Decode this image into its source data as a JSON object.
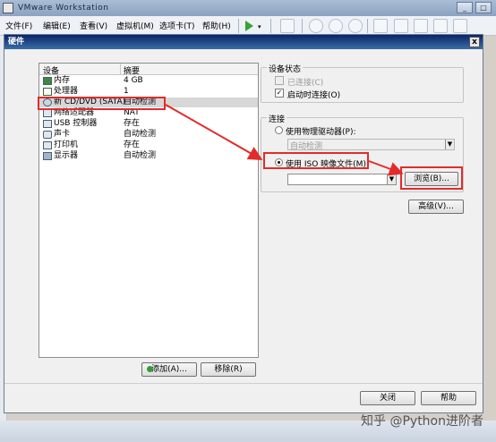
{
  "app": {
    "title": "VMware Workstation",
    "min": "_",
    "max": "□"
  },
  "menubar": {
    "items": [
      "文件(F)",
      "编辑(E)",
      "查看(V)",
      "虚拟机(M)",
      "选项卡(T)",
      "帮助(H)"
    ]
  },
  "dialog": {
    "title": "硬件",
    "close": "x",
    "list": {
      "headers": [
        "设备",
        "摘要"
      ],
      "rows": [
        {
          "icon": "memory-icon",
          "name": "内存",
          "summary": "4 GB"
        },
        {
          "icon": "cpu-icon",
          "name": "处理器",
          "summary": "1"
        },
        {
          "icon": "cd-dvd-icon",
          "name": "新 CD/DVD (SATA)",
          "summary": "自动检测"
        },
        {
          "icon": "network-adapter-icon",
          "name": "网络适配器",
          "summary": "NAT"
        },
        {
          "icon": "usb-icon",
          "name": "USB 控制器",
          "summary": "存在"
        },
        {
          "icon": "sound-card-icon",
          "name": "声卡",
          "summary": "自动检测"
        },
        {
          "icon": "printer-icon",
          "name": "打印机",
          "summary": "存在"
        },
        {
          "icon": "display-icon",
          "name": "显示器",
          "summary": "自动检测"
        }
      ]
    },
    "add_button": "添加(A)...",
    "remove_button": "移除(R)",
    "device_status": {
      "label": "设备状态",
      "connected": {
        "label": "已连接(C)",
        "checked": false
      },
      "connect_at_power_on": {
        "label": "启动时连接(O)",
        "checked": true
      }
    },
    "connection": {
      "label": "连接",
      "physical": {
        "label": "使用物理驱动器(P):",
        "selected": false
      },
      "physical_value": "自动检测",
      "iso": {
        "label": "使用 ISO 映像文件(M):",
        "selected": true
      },
      "iso_value": "",
      "browse": "浏览(B)..."
    },
    "advanced": "高级(V)...",
    "close_button": "关闭",
    "help_button": "帮助"
  },
  "watermark": "知乎 @Python进阶者",
  "colors": {
    "annotation_red": "#e32b2b",
    "dialog_bg": "#f0f0f0",
    "title_blue": "#0a246a"
  }
}
